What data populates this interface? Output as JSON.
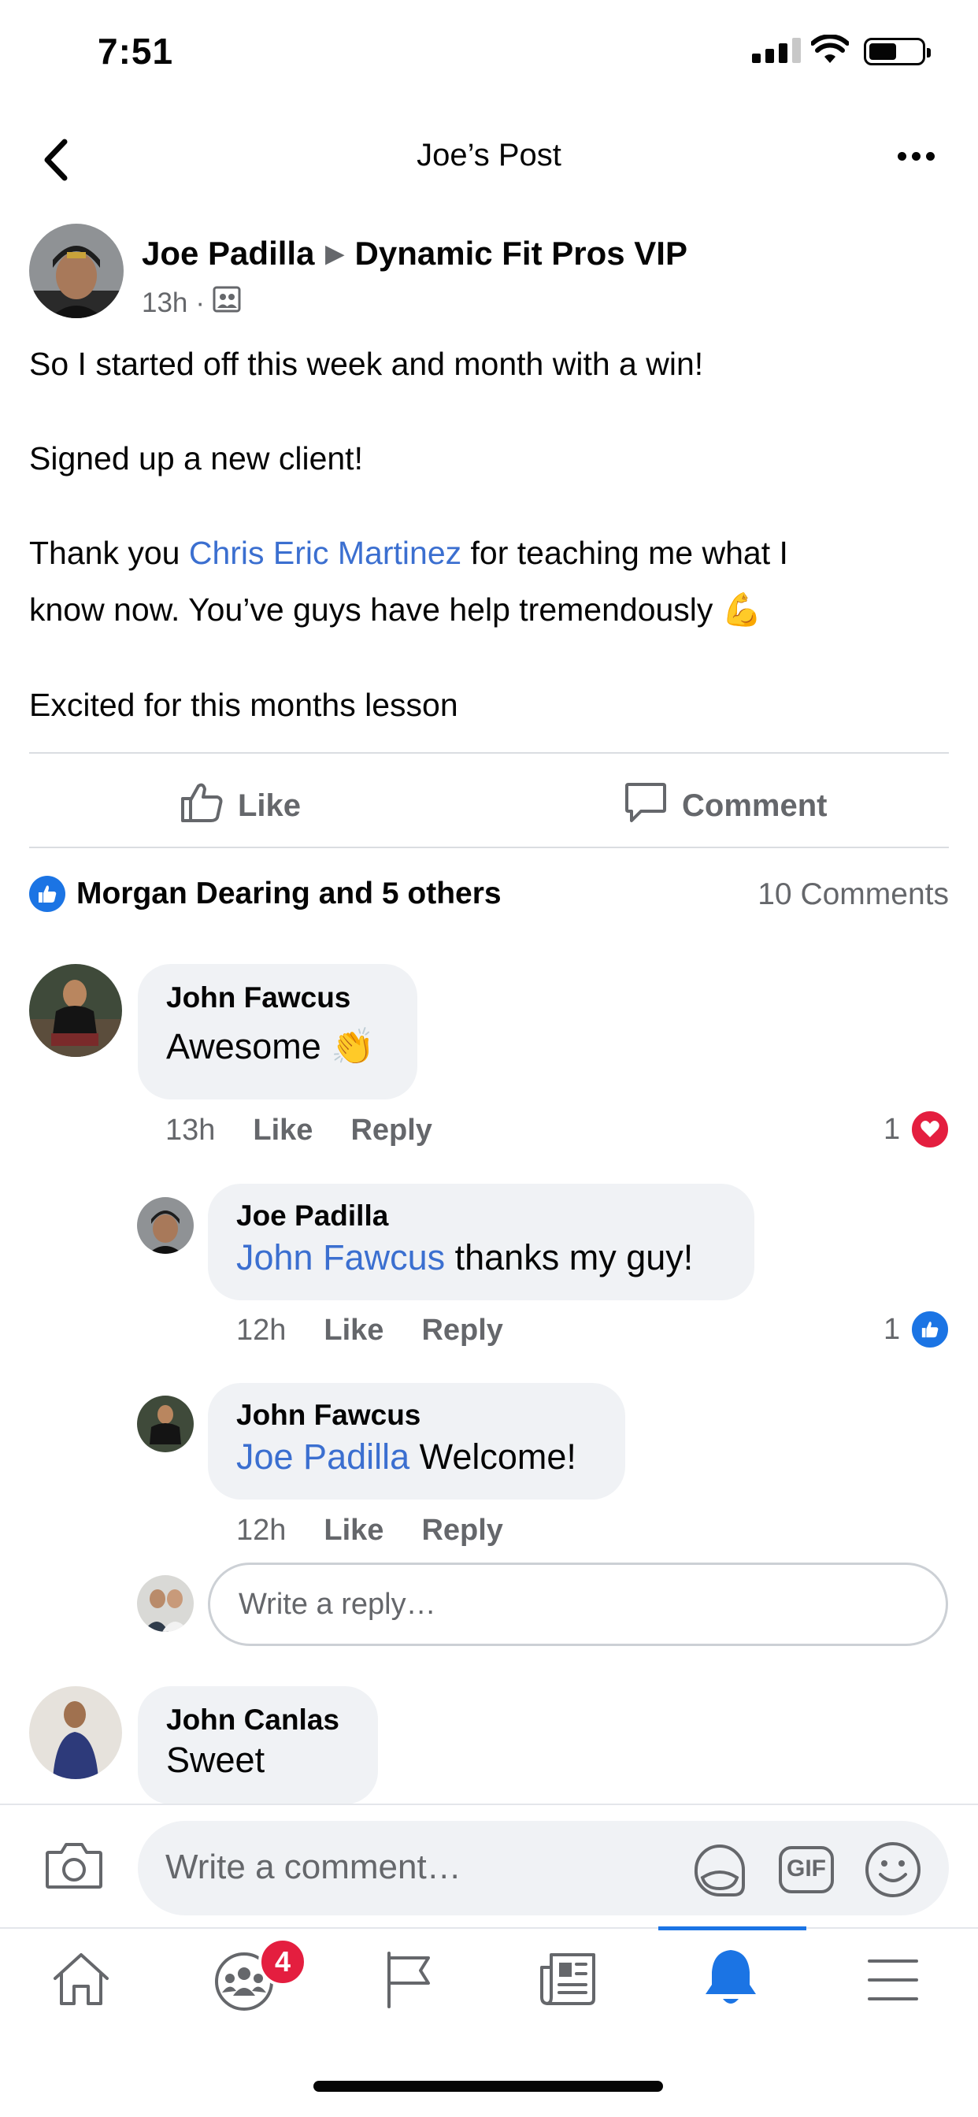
{
  "status": {
    "time": "7:51"
  },
  "header": {
    "title": "Joe’s Post"
  },
  "post": {
    "author": "Joe Padilla",
    "group": "Dynamic Fit Pros VIP",
    "time": "13h",
    "separator": "·",
    "line1": "So I started off this week and month with a win!",
    "line2": "Signed up a new client!",
    "line3_prefix": "Thank you ",
    "line3_mention": "Chris Eric Martinez",
    "line3_suffix": " for teaching me what I",
    "line4": "know now. You’ve guys have help tremendously",
    "line4_emoji": "💪",
    "line5": "Excited for this months lesson"
  },
  "actions": {
    "like": "Like",
    "comment": "Comment"
  },
  "summary": {
    "reactors": "Morgan Dearing and 5 others",
    "comments": "10 Comments"
  },
  "comments": [
    {
      "name": "John Fawcus",
      "text": "Awesome",
      "emoji": "👏",
      "time": "13h",
      "like": "Like",
      "reply": "Reply",
      "reaction_count": "1",
      "reaction": "love"
    },
    {
      "name": "Joe Padilla",
      "mention": "John Fawcus",
      "text": " thanks my guy!",
      "time": "12h",
      "like": "Like",
      "reply": "Reply",
      "reaction_count": "1",
      "reaction": "like"
    },
    {
      "name": "John Fawcus",
      "mention": "Joe Padilla",
      "text": " Welcome!",
      "time": "12h",
      "like": "Like",
      "reply": "Reply"
    },
    {
      "name": "John Canlas",
      "text": "Sweet"
    }
  ],
  "reply_box": {
    "placeholder": "Write a reply…"
  },
  "composer": {
    "placeholder": "Write a comment…",
    "gif_label": "GIF"
  },
  "tabbar": {
    "groups_badge": "4",
    "active_tab": "notifications"
  },
  "colors": {
    "accent": "#1b74e4",
    "link": "#3b6fd0",
    "love": "#e41e3f",
    "muted": "#65676b"
  }
}
